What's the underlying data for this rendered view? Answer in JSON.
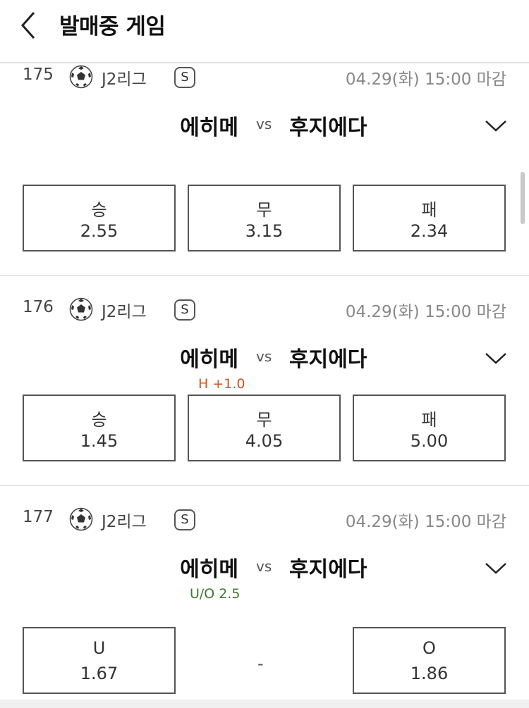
{
  "header": {
    "title": "발매중 게임"
  },
  "games": [
    {
      "no": "175",
      "league": "J2리그",
      "type_badge": "S",
      "deadline": "04.29(화) 15:00 마감",
      "home": "에히메",
      "vs": "vs",
      "away": "후지에다",
      "handicap": "",
      "odds": [
        {
          "label": "승",
          "value": "2.55"
        },
        {
          "label": "무",
          "value": "3.15"
        },
        {
          "label": "패",
          "value": "2.34"
        }
      ]
    },
    {
      "no": "176",
      "league": "J2리그",
      "type_badge": "S",
      "deadline": "04.29(화) 15:00 마감",
      "home": "에히메",
      "vs": "vs",
      "away": "후지에다",
      "handicap": "H +1.0",
      "odds": [
        {
          "label": "승",
          "value": "1.45"
        },
        {
          "label": "무",
          "value": "4.05"
        },
        {
          "label": "패",
          "value": "5.00"
        }
      ]
    },
    {
      "no": "177",
      "league": "J2리그",
      "type_badge": "S",
      "deadline": "04.29(화) 15:00 마감",
      "home": "에히메",
      "vs": "vs",
      "away": "후지에다",
      "handicap": "U/O 2.5",
      "odds": [
        {
          "label": "U",
          "value": "1.67"
        },
        {
          "label": "-",
          "value": ""
        },
        {
          "label": "O",
          "value": "1.86"
        }
      ]
    }
  ],
  "colors": {
    "handicap_h": "#d2521c",
    "handicap_uo": "#3a7a2c"
  }
}
